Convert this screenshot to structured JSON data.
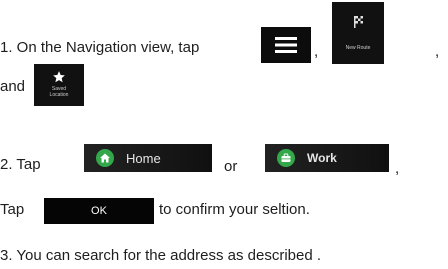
{
  "step1": {
    "text": "1. On the Navigation view, tap",
    "comma1": ",",
    "comma2": ",",
    "and": "and",
    "menu_icon": "hamburger-menu-icon",
    "new_route": {
      "icon": "checkered-flag-icon",
      "label": "New Route"
    },
    "saved_location": {
      "icon": "star-icon",
      "label_line1": "Saved",
      "label_line2": "Location"
    }
  },
  "step2": {
    "text": "2. Tap",
    "home_label": "Home",
    "home_icon": "house-icon",
    "or": "or",
    "work_label": "Work",
    "work_icon": "briefcase-icon",
    "comma": ","
  },
  "confirm": {
    "tap": "Tap",
    "ok_label": "OK",
    "rest": "to confirm your seltion."
  },
  "step3": {
    "text": "3. You can search for the address as described ."
  },
  "colors": {
    "accent_green": "#33a84b",
    "button_dark": "#0c0c0c"
  }
}
